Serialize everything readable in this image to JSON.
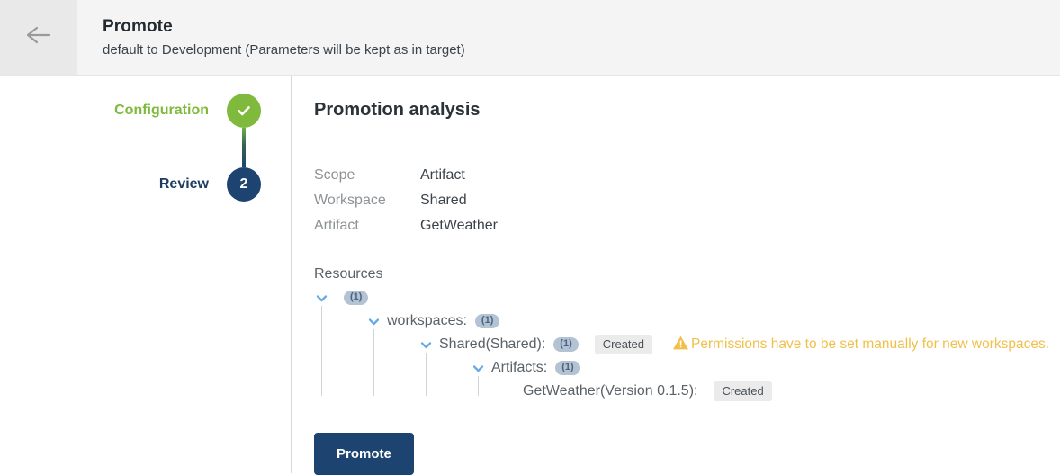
{
  "header": {
    "back_icon": "arrow-left-icon",
    "title": "Promote",
    "subtitle": "default to Development (Parameters will be kept as in target)"
  },
  "stepper": {
    "steps": [
      {
        "label": "Configuration",
        "bullet": "✓",
        "state": "done"
      },
      {
        "label": "Review",
        "bullet": "2",
        "state": "active"
      }
    ]
  },
  "analysis": {
    "title": "Promotion analysis",
    "summary": [
      {
        "key": "Scope",
        "value": "Artifact"
      },
      {
        "key": "Workspace",
        "value": "Shared"
      },
      {
        "key": "Artifact",
        "value": "GetWeather"
      }
    ],
    "resources_label": "Resources",
    "tree": {
      "root": {
        "count": "(1)"
      },
      "workspaces": {
        "label": "workspaces:",
        "count": "(1)"
      },
      "shared": {
        "label": "Shared(Shared):",
        "count": "(1)",
        "status": "Created",
        "warning": "Permissions have to be set manually for new workspaces."
      },
      "artifacts": {
        "label": "Artifacts:",
        "count": "(1)"
      },
      "getweather": {
        "label": "GetWeather(Version 0.1.5):",
        "status": "Created"
      }
    },
    "promote_button": "Promote"
  },
  "colors": {
    "green": "#7fba3d",
    "navy": "#1d4370",
    "warning": "#f0c04a",
    "chevron": "#6aaae4",
    "count_badge_bg": "#b3c3d4"
  }
}
